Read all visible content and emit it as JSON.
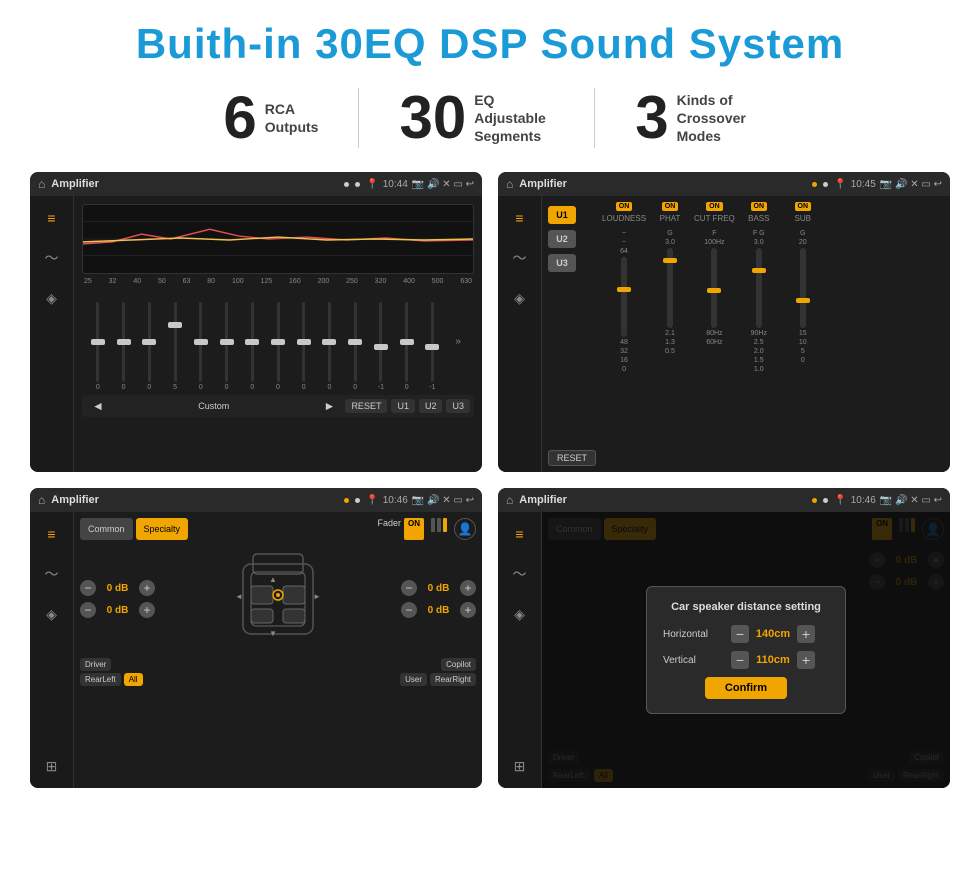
{
  "title": "Buith-in 30EQ DSP Sound System",
  "stats": [
    {
      "number": "6",
      "text": "RCA\nOutputs"
    },
    {
      "number": "30",
      "text": "EQ Adjustable\nSegments"
    },
    {
      "number": "3",
      "text": "Kinds of\nCrossover Modes"
    }
  ],
  "screens": [
    {
      "id": "eq-screen",
      "statusBar": {
        "time": "10:44",
        "appName": "Amplifier"
      },
      "type": "equalizer",
      "freqLabels": [
        "25",
        "32",
        "40",
        "50",
        "63",
        "80",
        "100",
        "125",
        "160",
        "200",
        "250",
        "320",
        "400",
        "500",
        "630"
      ],
      "sliderValues": [
        "0",
        "0",
        "0",
        "5",
        "0",
        "0",
        "0",
        "0",
        "0",
        "0",
        "0",
        "-1",
        "0",
        "-1"
      ],
      "bottomButtons": [
        "◄",
        "Custom",
        "►",
        "RESET",
        "U1",
        "U2",
        "U3"
      ]
    },
    {
      "id": "amp-presets-screen",
      "statusBar": {
        "time": "10:45",
        "appName": "Amplifier"
      },
      "type": "amplifier",
      "presets": [
        "U1",
        "U2",
        "U3"
      ],
      "channels": [
        {
          "label": "LOUDNESS",
          "on": true
        },
        {
          "label": "PHAT",
          "on": true
        },
        {
          "label": "CUT FREQ",
          "on": true
        },
        {
          "label": "BASS",
          "on": true
        },
        {
          "label": "SUB",
          "on": true
        }
      ],
      "resetButton": "RESET"
    },
    {
      "id": "speaker-layout-screen",
      "statusBar": {
        "time": "10:46",
        "appName": "Amplifier"
      },
      "type": "speaker-layout",
      "tabs": [
        "Common",
        "Specialty"
      ],
      "activeTab": "Specialty",
      "faderLabel": "Fader",
      "faderOn": true,
      "volumes": [
        {
          "label": "",
          "value": "0 dB"
        },
        {
          "label": "",
          "value": "0 dB"
        },
        {
          "label": "",
          "value": "0 dB"
        },
        {
          "label": "",
          "value": "0 dB"
        }
      ],
      "speakerButtons": [
        "Driver",
        "RearLeft",
        "All",
        "User",
        "RearRight",
        "Copilot"
      ]
    },
    {
      "id": "speaker-distance-screen",
      "statusBar": {
        "time": "10:46",
        "appName": "Amplifier"
      },
      "type": "speaker-distance",
      "tabs": [
        "Common",
        "Specialty"
      ],
      "activeTab": "Specialty",
      "faderOn": true,
      "dialog": {
        "title": "Car speaker distance setting",
        "fields": [
          {
            "label": "Horizontal",
            "value": "140cm"
          },
          {
            "label": "Vertical",
            "value": "110cm"
          }
        ],
        "confirmButton": "Confirm"
      },
      "speakerButtons": [
        "Driver",
        "RearLeft",
        "All",
        "User",
        "RearRight",
        "Copilot"
      ],
      "rightVolumes": [
        {
          "value": "0 dB"
        },
        {
          "value": "0 dB"
        }
      ]
    }
  ]
}
